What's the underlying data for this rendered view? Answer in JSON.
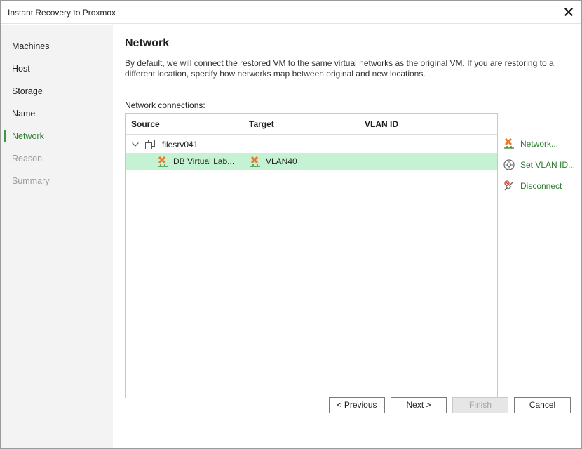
{
  "window": {
    "title": "Instant Recovery to Proxmox"
  },
  "sidebar": {
    "steps": [
      {
        "label": "Machines",
        "state": "done"
      },
      {
        "label": "Host",
        "state": "done"
      },
      {
        "label": "Storage",
        "state": "done"
      },
      {
        "label": "Name",
        "state": "done"
      },
      {
        "label": "Network",
        "state": "active"
      },
      {
        "label": "Reason",
        "state": "disabled"
      },
      {
        "label": "Summary",
        "state": "disabled"
      }
    ]
  },
  "main": {
    "heading": "Network",
    "description": "By default, we will connect the restored VM to the same virtual networks as the original VM. If you are restoring to a different location, specify how networks map between original and new locations.",
    "connections_label": "Network connections:",
    "columns": [
      "Source",
      "Target",
      "VLAN ID"
    ],
    "tree": {
      "vm_name": "filesrv041",
      "mapping": {
        "source": "DB Virtual Lab...",
        "target": "VLAN40",
        "vlan_id": ""
      }
    }
  },
  "actions": {
    "network": "Network...",
    "set_vlan": "Set VLAN ID...",
    "disconnect": "Disconnect"
  },
  "footer": {
    "previous": "< Previous",
    "next": "Next >",
    "finish": "Finish",
    "cancel": "Cancel"
  },
  "colors": {
    "accent_green": "#2e7d32",
    "selection": "#c4f2d2",
    "network_icon_orange": "#e8792c"
  }
}
